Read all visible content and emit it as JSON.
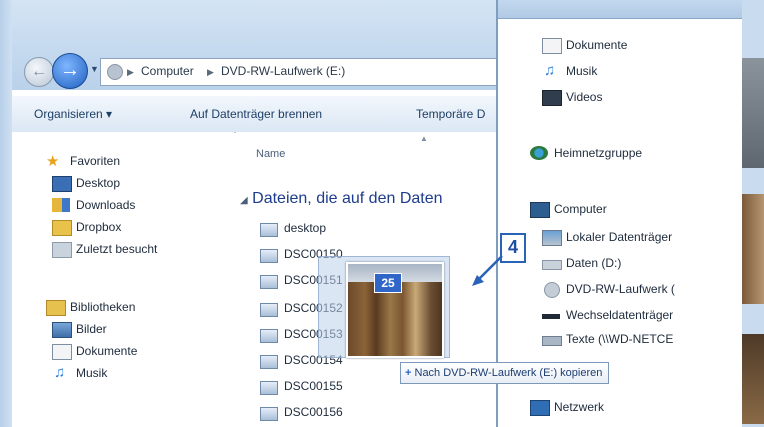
{
  "left_window": {
    "breadcrumb": [
      "Computer",
      "DVD-RW-Laufwerk (E:)"
    ],
    "toolbar": {
      "organize_label": "Organisieren ▾",
      "burn_label": "Auf Datenträger brennen",
      "temp_label": "Temporäre D"
    },
    "nav": {
      "favorites": {
        "label": "Favoriten",
        "items": [
          "Desktop",
          "Downloads",
          "Dropbox",
          "Zuletzt besucht"
        ]
      },
      "libraries": {
        "label": "Bibliotheken",
        "items": [
          "Bilder",
          "Dokumente",
          "Musik"
        ]
      }
    },
    "content": {
      "column_header": "Name",
      "group_label": "Dateien, die auf den Daten",
      "files": [
        "desktop",
        "DSC00150",
        "DSC00151",
        "DSC00152",
        "DSC00153",
        "DSC00154",
        "DSC00155",
        "DSC00156"
      ]
    }
  },
  "right_window": {
    "items": [
      {
        "label": "Dokumente",
        "icon": "documents-icon"
      },
      {
        "label": "Musik",
        "icon": "music-icon"
      },
      {
        "label": "Videos",
        "icon": "videos-icon"
      },
      {
        "label": "Heimnetzgruppe",
        "icon": "homegroup-icon"
      },
      {
        "label": "Computer",
        "icon": "computer-icon"
      },
      {
        "label": "Lokaler Datenträger",
        "icon": "local-disk-icon"
      },
      {
        "label": "Daten (D:)",
        "icon": "drive-icon"
      },
      {
        "label": "DVD-RW-Laufwerk (",
        "icon": "dvd-drive-icon"
      },
      {
        "label": "Wechseldatenträger",
        "icon": "removable-drive-icon"
      },
      {
        "label": "Texte (\\\\WD-NETCE",
        "icon": "network-drive-icon"
      },
      {
        "label": "Netzwerk",
        "icon": "network-icon"
      }
    ]
  },
  "drag": {
    "count": "25",
    "tooltip": "Nach DVD-RW-Laufwerk (E:) kopieren"
  },
  "step_badge": "4",
  "colors": {
    "accent": "#2f66c8",
    "group_heading": "#1e3c8c",
    "step_border": "#2a62b8"
  }
}
